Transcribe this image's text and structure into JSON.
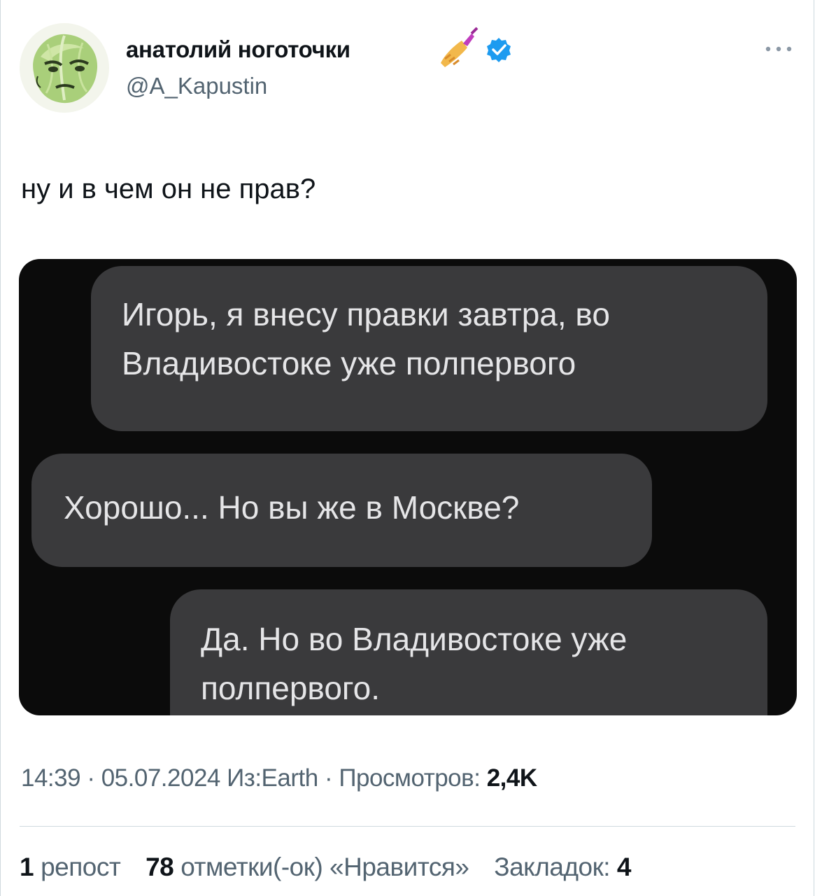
{
  "author": {
    "display_name": "анатолий ноготочки",
    "handle": "@A_Kapustin",
    "verified": true,
    "name_emoji": "nail-polish",
    "avatar": "cabbage-face",
    "more_icon": "more-horizontal-icon"
  },
  "tweet": {
    "text": "ну и в чем он не прав?"
  },
  "media": {
    "messages": [
      {
        "lines": [
          "Игорь, я внесу правки завтра, во",
          "Владивостоке уже полпервого"
        ]
      },
      {
        "lines": [
          "Хорошо... Но вы же в Москве?"
        ]
      },
      {
        "lines": [
          "Да. Но во Владивостоке уже",
          "полпервого."
        ]
      }
    ]
  },
  "meta": {
    "time": "14:39",
    "date": "05.07.2024",
    "source": "Из:Earth",
    "views_label": "Просмотров:",
    "views_value": "2,4K"
  },
  "stats": {
    "reposts_count": "1",
    "reposts_label": "репост",
    "likes_count": "78",
    "likes_label": "отметки(-ок) «Нравится»",
    "bookmarks_label": "Закладок:",
    "bookmarks_count": "4"
  },
  "colors": {
    "verified": "#1d9bf0",
    "secondary_text": "#536471",
    "bubble": "#3a3a3c",
    "media_bg": "#0b0b0b"
  }
}
